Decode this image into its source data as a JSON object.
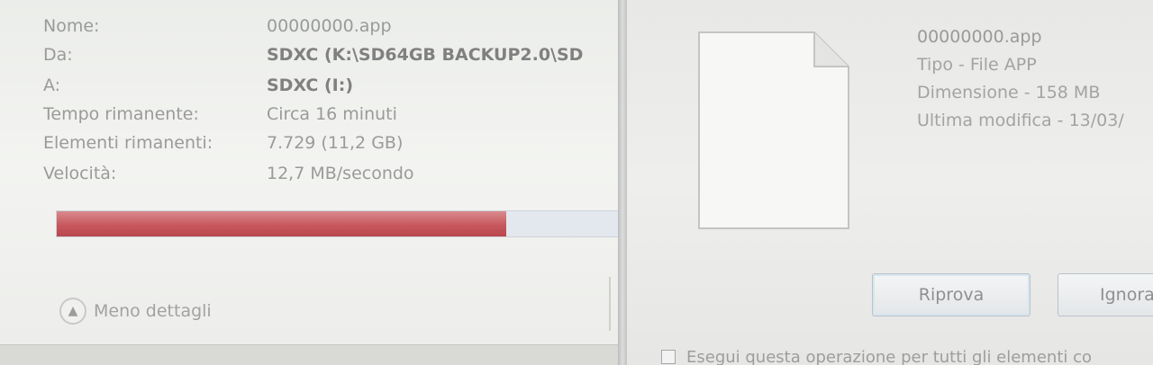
{
  "copy_progress": {
    "rows": [
      {
        "label": "Nome:",
        "value": "00000000.app",
        "strong": false
      },
      {
        "label": "Da:",
        "value": "SDXC (K:\\SD64GB BACKUP2.0\\SD",
        "strong": true
      },
      {
        "label": "A:",
        "value": "SDXC (I:)",
        "strong": true
      },
      {
        "label": "Tempo rimanente:",
        "value": "Circa 16 minuti",
        "strong": false
      },
      {
        "label": "Elementi rimanenti:",
        "value": "7.729 (11,2 GB)",
        "strong": false
      },
      {
        "label": "Velocità:",
        "value": "12,7 MB/secondo",
        "strong": false
      }
    ],
    "progress_fraction": 0.8,
    "progress_color": "#c7585e",
    "less_details_label": "Meno dettagli",
    "less_details_icon": "chevron-up-icon"
  },
  "conflict_dialog": {
    "file_icon": "document-icon",
    "file_name": "00000000.app",
    "file_type": "Tipo - File APP",
    "file_size": "Dimensione - 158 MB",
    "file_modified": "Ultima modifica - 13/03/",
    "retry_label": "Riprova",
    "ignore_label": "Ignora",
    "apply_all_label": "Esegui questa operazione per tutti gli elementi co"
  }
}
